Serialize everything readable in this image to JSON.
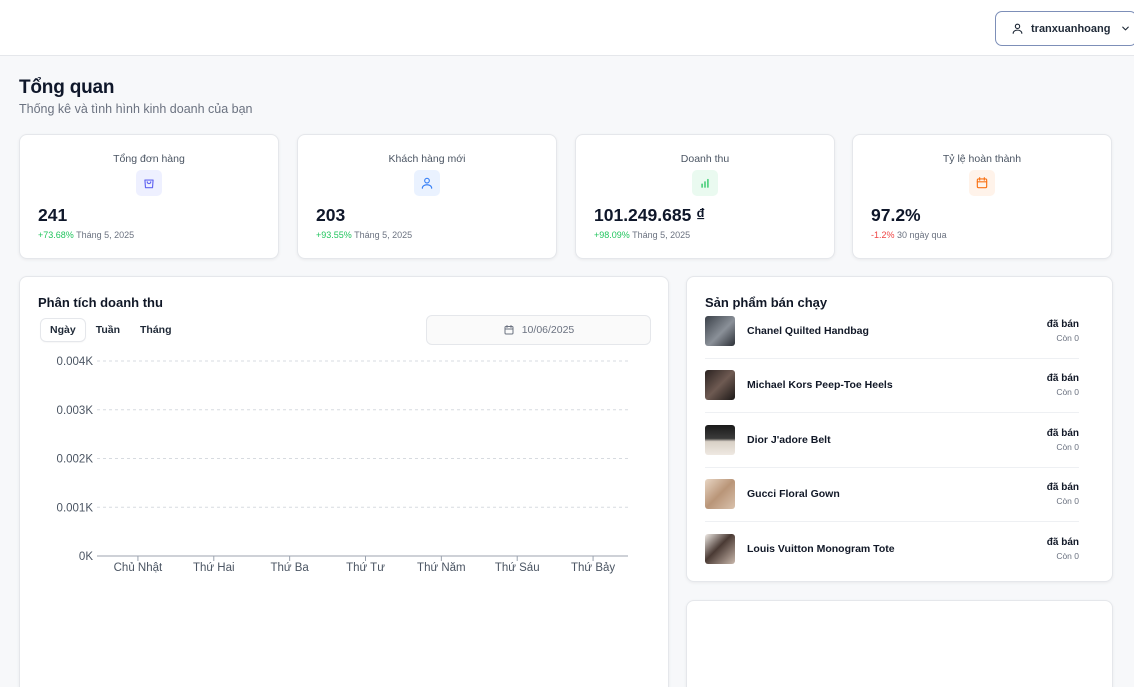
{
  "user": {
    "username": "tranxuanhoang"
  },
  "header": {
    "title": "Tổng quan",
    "subtitle": "Thống kê và tình hình kinh doanh của bạn"
  },
  "stats": [
    {
      "label": "Tổng đơn hàng",
      "value": "241",
      "change": "+73.68%",
      "period": "Tháng 5, 2025",
      "icon": "shopping-bag-icon",
      "color": "#6366f1",
      "trend": "up"
    },
    {
      "label": "Khách hàng mới",
      "value": "203",
      "change": "+93.55%",
      "period": "Tháng 5, 2025",
      "icon": "user-icon",
      "color": "#3b82f6",
      "trend": "up"
    },
    {
      "label": "Doanh thu",
      "value": "101.249.685 ₫",
      "change": "+98.09%",
      "period": "Tháng 5, 2025",
      "icon": "bar-chart-icon",
      "color": "#22c55e",
      "trend": "up"
    },
    {
      "label": "Tỷ lệ hoàn thành",
      "value": "97.2%",
      "change": "-1.2%",
      "period": "30 ngày qua",
      "icon": "calendar-icon",
      "color": "#f97316",
      "trend": "down"
    }
  ],
  "revenue": {
    "title": "Phân tích doanh thu",
    "tabs": [
      "Ngày",
      "Tuần",
      "Tháng"
    ],
    "active_tab": "Ngày",
    "date": "10/06/2025"
  },
  "chart_data": {
    "type": "line",
    "categories": [
      "Chủ Nhật",
      "Thứ Hai",
      "Thứ Ba",
      "Thứ Tư",
      "Thứ Năm",
      "Thứ Sáu",
      "Thứ Bảy"
    ],
    "values": [
      0,
      0,
      0,
      0,
      0,
      0,
      0
    ],
    "ytick_labels": [
      "0K",
      "0.001K",
      "0.002K",
      "0.003K",
      "0.004K"
    ],
    "ylim": [
      0,
      0.004
    ],
    "grid": true,
    "title": "",
    "xlabel": "",
    "ylabel": ""
  },
  "products": {
    "title": "Sản phẩm bán chạy",
    "items": [
      {
        "name": "Chanel Quilted Handbag",
        "sold": "đã bán",
        "stock": "Còn 0"
      },
      {
        "name": "Michael Kors Peep-Toe Heels",
        "sold": "đã bán",
        "stock": "Còn 0"
      },
      {
        "name": "Dior J'adore Belt",
        "sold": "đã bán",
        "stock": "Còn 0"
      },
      {
        "name": "Gucci Floral Gown",
        "sold": "đã bán",
        "stock": "Còn 0"
      },
      {
        "name": "Louis Vuitton Monogram Tote",
        "sold": "đã bán",
        "stock": "Còn 0"
      }
    ]
  }
}
